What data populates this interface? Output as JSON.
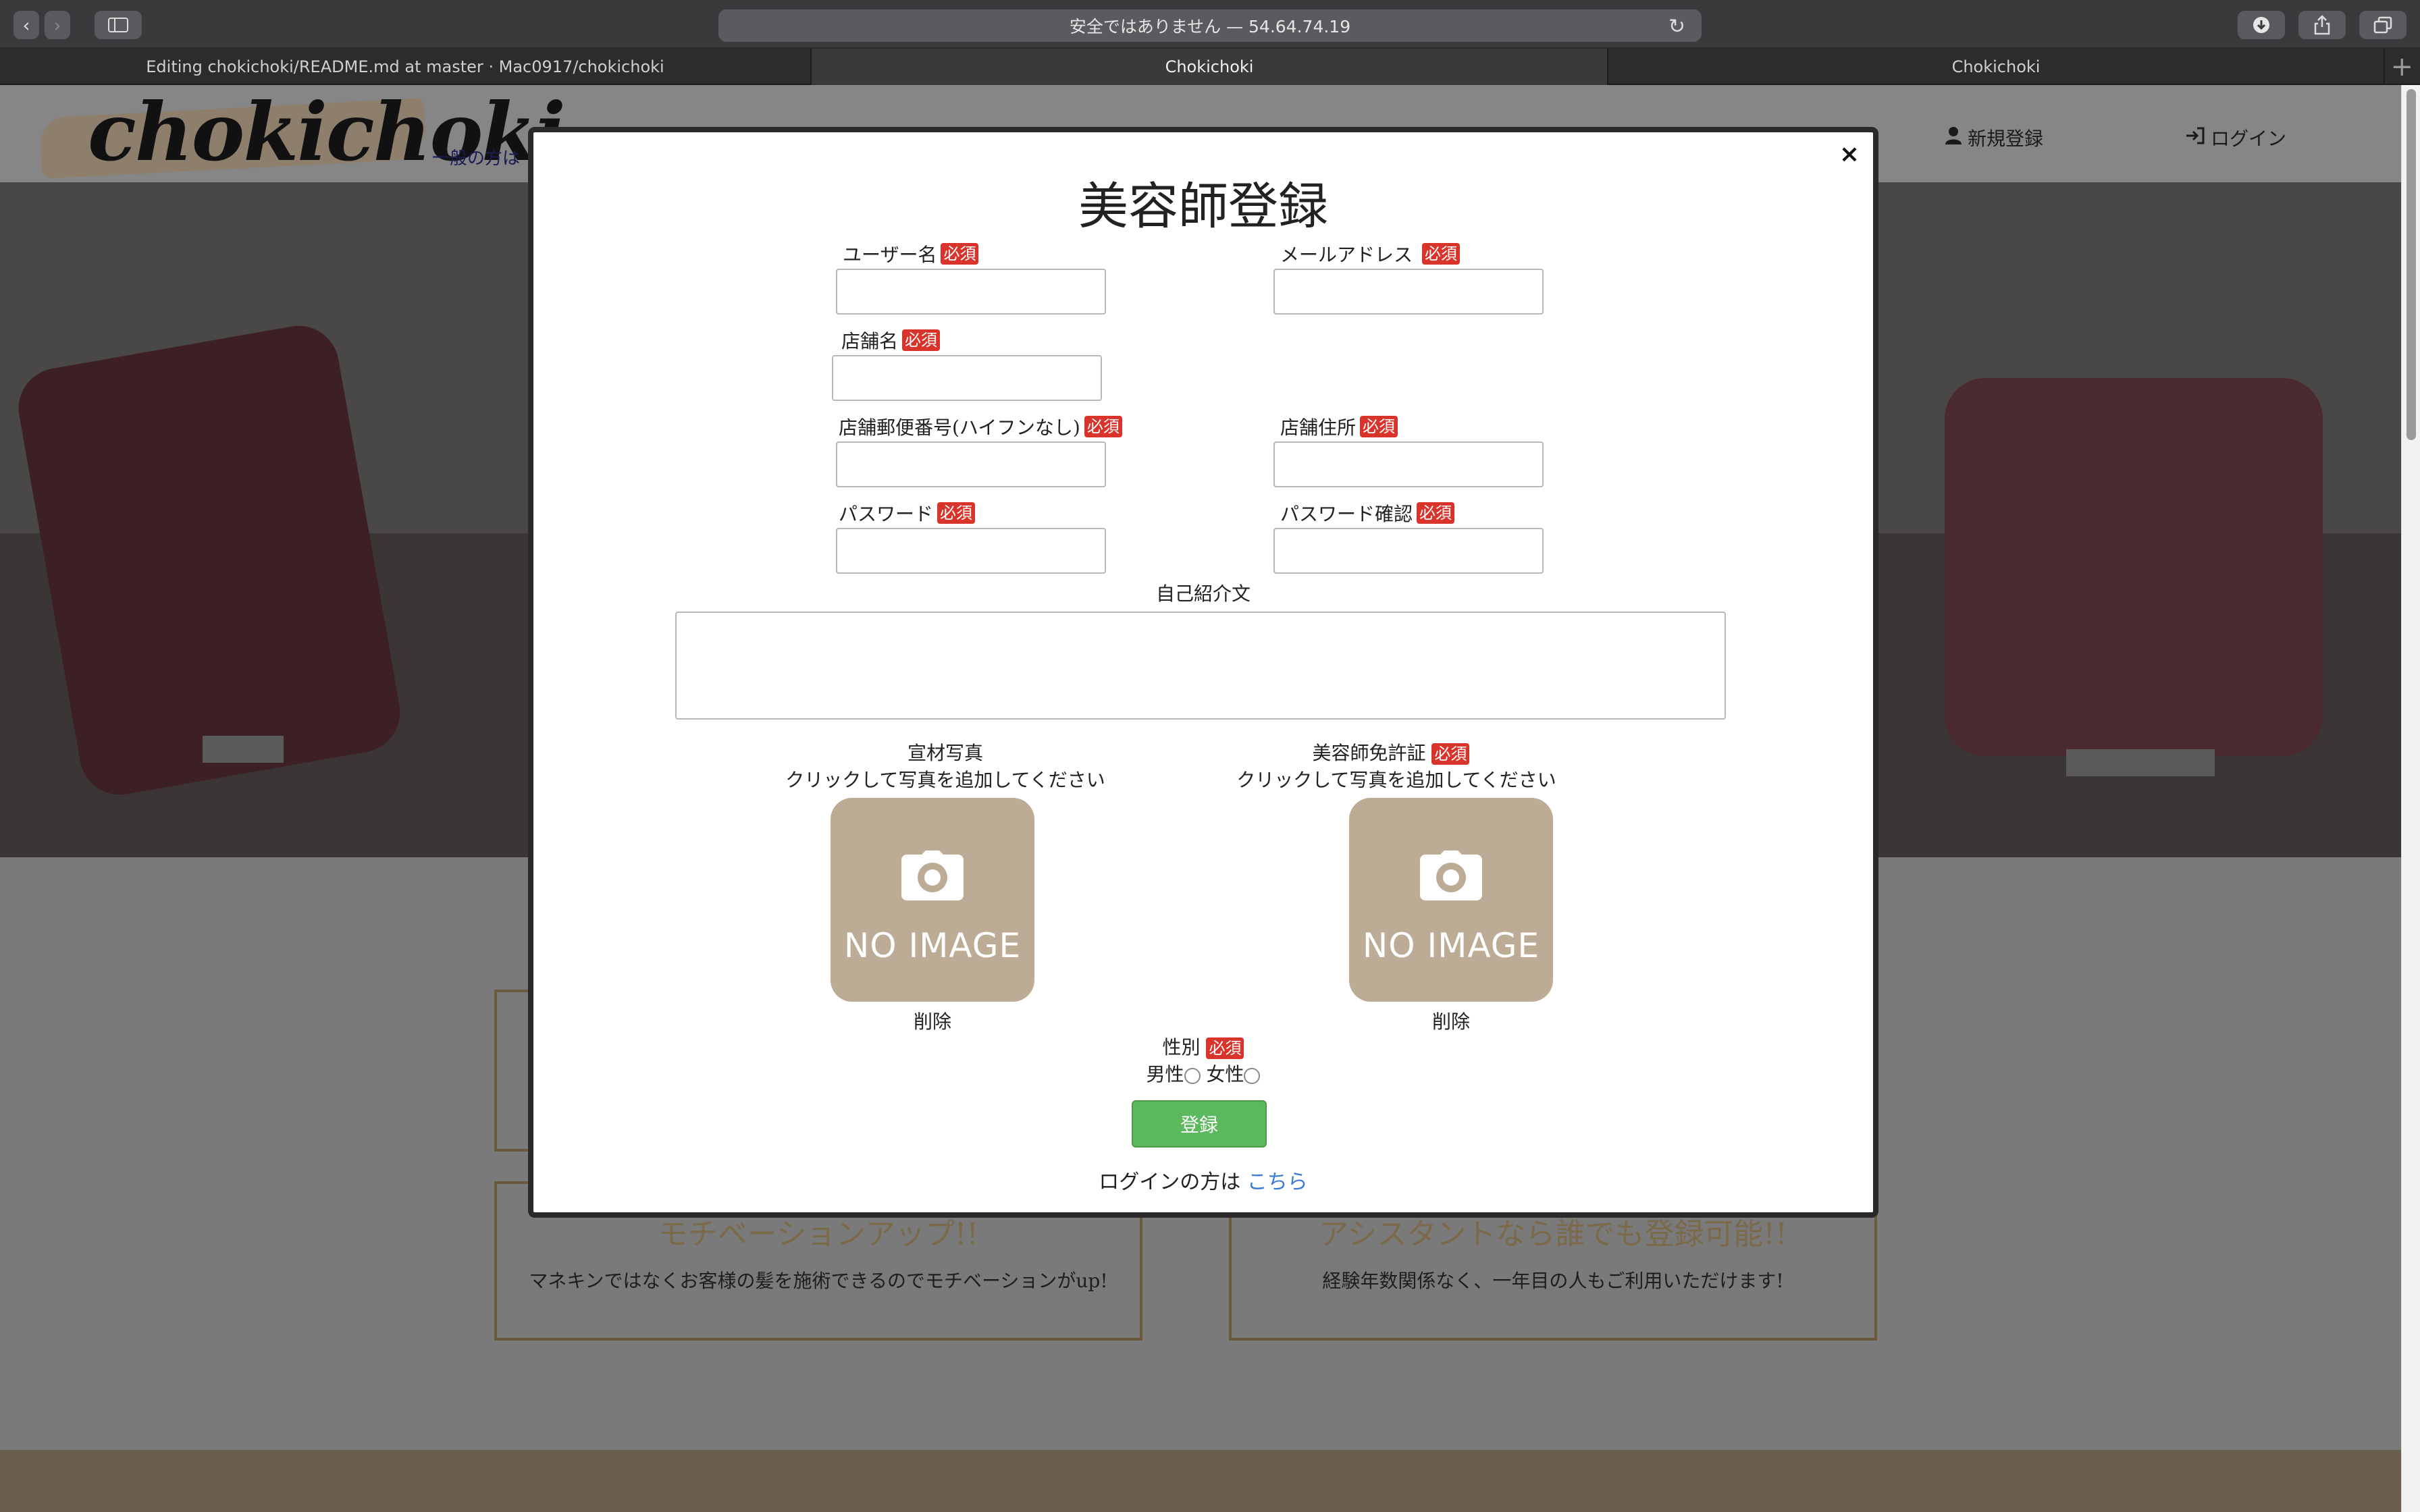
{
  "browser": {
    "url_text": "安全ではありません — 54.64.74.19",
    "tabs": [
      {
        "title": "Editing chokichoki/README.md at master · Mac0917/chokichoki"
      },
      {
        "title": "Chokichoki"
      },
      {
        "title": "Chokichoki"
      }
    ],
    "icons": [
      "back-icon",
      "forward-icon",
      "sidebar-icon",
      "reload-icon",
      "download-icon",
      "share-icon",
      "tabs-overview-icon",
      "new-tab-icon"
    ]
  },
  "site": {
    "logo": "chokichoki",
    "logo_sub": "一般の方は",
    "nav": {
      "signup": "新規登録",
      "login": "ログイン"
    },
    "features": [
      {
        "title": "モチベーションアップ!!",
        "text": "マネキンではなくお客様の髪を施術できるのでモチベーションがup!"
      },
      {
        "title": "アシスタントなら誰でも登録可能!!",
        "text": "経験年数関係なく、一年目の人もご利用いただけます!"
      }
    ]
  },
  "modal": {
    "close": "×",
    "title": "美容師登録",
    "required": "必須",
    "fields": {
      "username": "ユーザー名",
      "email": "メールアドレス",
      "shop_name": "店舗名",
      "shop_postal": "店舗郵便番号(ハイフンなし)",
      "shop_address": "店舗住所",
      "password": "パスワード",
      "password_confirm": "パスワード確認",
      "intro": "自己紹介文"
    },
    "photo": {
      "material_title": "宣材写真",
      "license_title": "美容師免許証",
      "hint": "クリックして写真を追加してください",
      "no_image": "NO IMAGE",
      "delete": "削除"
    },
    "gender": {
      "label": "性別",
      "male": "男性",
      "female": "女性"
    },
    "submit": "登録",
    "login_prompt": "ログインの方は",
    "login_link": "こちら"
  }
}
